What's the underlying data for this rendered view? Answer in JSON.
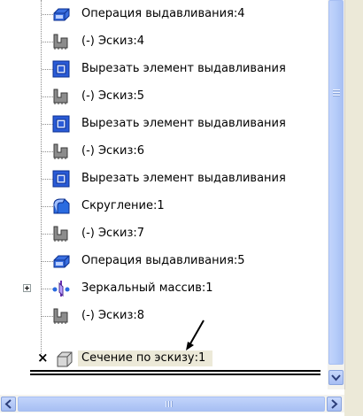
{
  "tree": {
    "items": [
      {
        "label": "Операция выдавливания:4",
        "icon": "extrude-boss-icon"
      },
      {
        "label": "(-) Эскиз:4",
        "icon": "sketch-icon"
      },
      {
        "label": "Вырезать элемент выдавливания",
        "icon": "cut-extrude-icon"
      },
      {
        "label": "(-) Эскиз:5",
        "icon": "sketch-icon"
      },
      {
        "label": "Вырезать элемент выдавливания",
        "icon": "cut-extrude-icon"
      },
      {
        "label": "(-) Эскиз:6",
        "icon": "sketch-icon"
      },
      {
        "label": "Вырезать элемент выдавливания",
        "icon": "cut-extrude-icon"
      },
      {
        "label": "Скругление:1",
        "icon": "fillet-icon"
      },
      {
        "label": "(-) Эскиз:7",
        "icon": "sketch-icon"
      },
      {
        "label": "Операция выдавливания:5",
        "icon": "extrude-boss-icon"
      },
      {
        "label": "Зеркальный массив:1",
        "icon": "mirror-icon"
      },
      {
        "label": "(-) Эскиз:8",
        "icon": "sketch-icon"
      },
      {
        "label": "Сечение по эскизу:1",
        "icon": "section-icon"
      }
    ]
  },
  "colors": {
    "accent_blue": "#1f4fd1",
    "selection": "#ece9d8",
    "scrollbar": "#b5ccf9"
  }
}
